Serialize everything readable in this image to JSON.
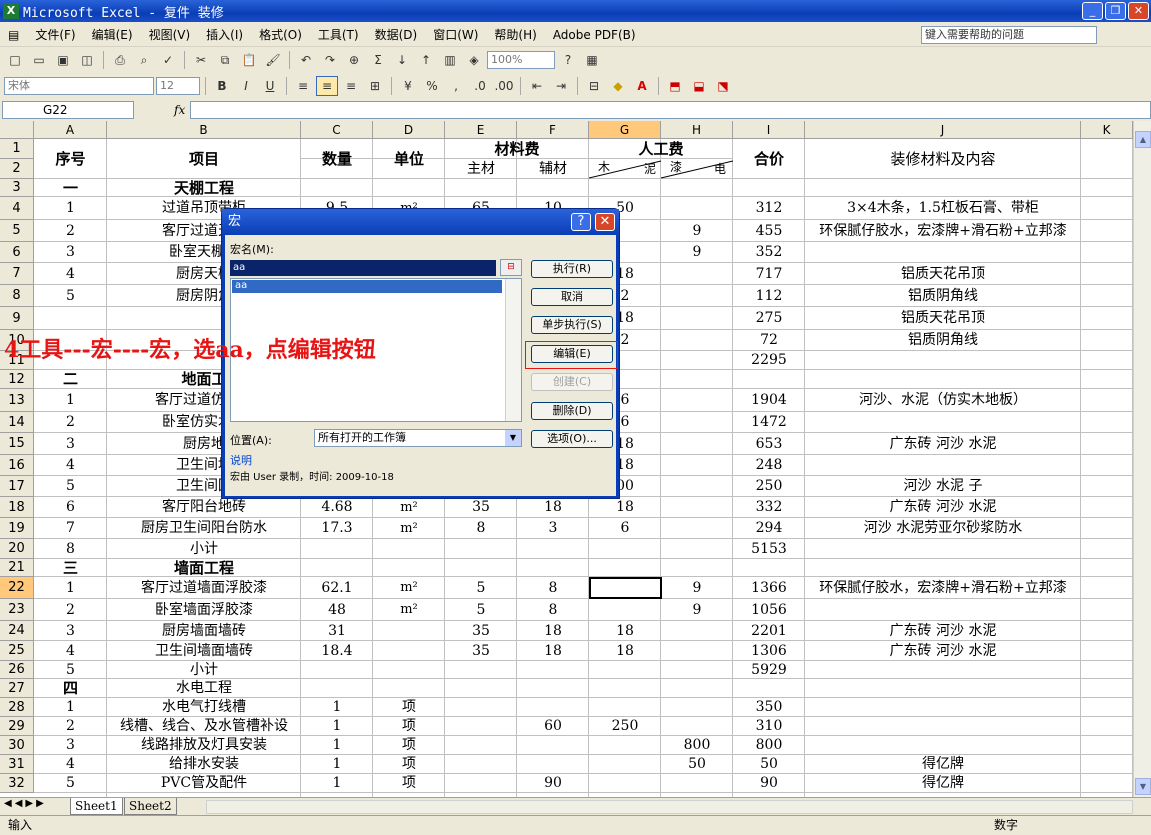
{
  "window": {
    "title": "Microsoft Excel - 复件 装修"
  },
  "menu": [
    "文件(F)",
    "编辑(E)",
    "视图(V)",
    "插入(I)",
    "格式(O)",
    "工具(T)",
    "数据(D)",
    "窗口(W)",
    "帮助(H)",
    "Adobe PDF(B)"
  ],
  "help_placeholder": "键入需要帮助的问题",
  "toolbar": {
    "zoom": "100%",
    "font": "宋体",
    "font_size": "12"
  },
  "formula_bar": {
    "name_box": "G22",
    "fx": "fx"
  },
  "columns": [
    "A",
    "B",
    "C",
    "D",
    "E",
    "F",
    "G",
    "H",
    "I",
    "J",
    "K"
  ],
  "header_cells": {
    "seq": "序号",
    "item": "项目",
    "qty": "数量",
    "unit": "单位",
    "material": "材料费",
    "main": "主材",
    "aux": "辅材",
    "labor": "人工费",
    "wood": "木",
    "mud": "泥",
    "paint": "漆",
    "elec": "电",
    "total": "合价",
    "desc": "装修材料及内容"
  },
  "rows": [
    {
      "r": "3",
      "A": "一",
      "B": "天棚工程",
      "bold": true
    },
    {
      "r": "4",
      "A": "1",
      "B": "过道吊顶带柜",
      "C": "9.5",
      "D": "m²",
      "E": "65",
      "F": "10",
      "G": "50",
      "I": "312",
      "J": "3×4木条，1.5杠板石膏、带柜"
    },
    {
      "r": "5",
      "A": "2",
      "B": "客厅过道天棚",
      "H": "9",
      "I": "455",
      "J": "环保腻仔胶水，宏漆牌+滑石粉+立邦漆"
    },
    {
      "r": "6",
      "A": "3",
      "B": "卧室天棚浮",
      "H": "9",
      "I": "352"
    },
    {
      "r": "7",
      "A": "4",
      "B": "厨房天棚",
      "G": "18",
      "I": "717",
      "J": "铝质天花吊顶"
    },
    {
      "r": "8",
      "A": "5",
      "B": "厨房阴角",
      "G": "2",
      "I": "112",
      "J": "铝质阴角线"
    },
    {
      "r": "9",
      "G": "18",
      "I": "275",
      "J": "铝质天花吊顶"
    },
    {
      "r": "10",
      "G": "2",
      "I": "72",
      "J": "铝质阴角线"
    },
    {
      "r": "11",
      "I": "2295"
    },
    {
      "r": "12",
      "A": "二",
      "B": "地面工",
      "bold": true
    },
    {
      "r": "13",
      "A": "1",
      "B": "客厅过道仿实木",
      "G": "6",
      "I": "1904",
      "J": "河沙、水泥（仿实木地板）"
    },
    {
      "r": "14",
      "A": "2",
      "B": "卧室仿实木地",
      "G": "6",
      "I": "1472"
    },
    {
      "r": "15",
      "A": "3",
      "B": "厨房地",
      "G": "18",
      "I": "653",
      "J": "广东砖 河沙 水泥"
    },
    {
      "r": "16",
      "A": "4",
      "B": "卫生间地",
      "G": "18",
      "I": "248"
    },
    {
      "r": "17",
      "A": "5",
      "B": "卫生间回",
      "G": "00",
      "I": "250",
      "J": "河沙 水泥  子"
    },
    {
      "r": "18",
      "A": "6",
      "B": "客厅阳台地砖",
      "C": "4.68",
      "D": "m²",
      "E": "35",
      "F": "18",
      "G": "18",
      "I": "332",
      "J": "广东砖 河沙 水泥"
    },
    {
      "r": "19",
      "A": "7",
      "B": "厨房卫生间阳台防水",
      "C": "17.3",
      "D": "m²",
      "E": "8",
      "F": "3",
      "G": "6",
      "I": "294",
      "J": "河沙 水泥劳亚尔砂浆防水"
    },
    {
      "r": "20",
      "A": "8",
      "B": "小计",
      "I": "5153"
    },
    {
      "r": "21",
      "A": "三",
      "B": "墙面工程",
      "bold": true
    },
    {
      "r": "22",
      "A": "1",
      "B": "客厅过道墙面浮胶漆",
      "C": "62.1",
      "D": "m²",
      "E": "5",
      "F": "8",
      "H": "9",
      "I": "1366",
      "J": "环保腻仔胶水，宏漆牌+滑石粉+立邦漆"
    },
    {
      "r": "23",
      "A": "2",
      "B": "卧室墙面浮胶漆",
      "C": "48",
      "D": "m²",
      "E": "5",
      "F": "8",
      "H": "9",
      "I": "1056"
    },
    {
      "r": "24",
      "A": "3",
      "B": "厨房墙面墙砖",
      "C": "31",
      "E": "35",
      "F": "18",
      "G": "18",
      "I": "2201",
      "J": "广东砖 河沙 水泥"
    },
    {
      "r": "25",
      "A": "4",
      "B": "卫生间墙面墙砖",
      "C": "18.4",
      "E": "35",
      "F": "18",
      "G": "18",
      "I": "1306",
      "J": "广东砖 河沙 水泥"
    },
    {
      "r": "26",
      "A": "5",
      "B": "小计",
      "I": "5929"
    },
    {
      "r": "27",
      "A": "四",
      "B": "水电工程",
      "boldA": true
    },
    {
      "r": "28",
      "A": "1",
      "B": "水电气打线槽",
      "C": "1",
      "D": "项",
      "I": "350"
    },
    {
      "r": "29",
      "A": "2",
      "B": "线槽、线合、及水管槽补设",
      "C": "1",
      "D": "项",
      "F": "60",
      "G": "250",
      "I": "310"
    },
    {
      "r": "30",
      "A": "3",
      "B": "线路排放及灯具安装",
      "C": "1",
      "D": "项",
      "H": "800",
      "I": "800"
    },
    {
      "r": "31",
      "A": "4",
      "B": "给排水安装",
      "C": "1",
      "D": "项",
      "H": "50",
      "I": "50",
      "J": "得亿牌"
    },
    {
      "r": "32",
      "A": "5",
      "B": "PVC管及配件",
      "C": "1",
      "D": "项",
      "F": "90",
      "I": "90",
      "J": "得亿牌"
    }
  ],
  "dialog": {
    "title": "宏",
    "macro_name_label": "宏名(M):",
    "macro_name_value": "aa",
    "list_items": [
      "aa"
    ],
    "buttons": [
      "执行(R)",
      "取消",
      "单步执行(S)",
      "编辑(E)",
      "创建(C)",
      "删除(D)",
      "选项(O)..."
    ],
    "location_label": "位置(A):",
    "location_value": "所有打开的工作簿",
    "desc_label": "说明",
    "desc_text": "宏由 User 录制，时间: 2009-10-18"
  },
  "annotation": "4工具---宏----宏，选aa，点编辑按钮",
  "sheets": [
    "Sheet1",
    "Sheet2"
  ],
  "status": {
    "left": "输入",
    "right": "数字"
  },
  "colors": {
    "title_blue": "#0a3eb6",
    "selected_header": "#ffc87a",
    "annotation_red": "#e81414"
  }
}
